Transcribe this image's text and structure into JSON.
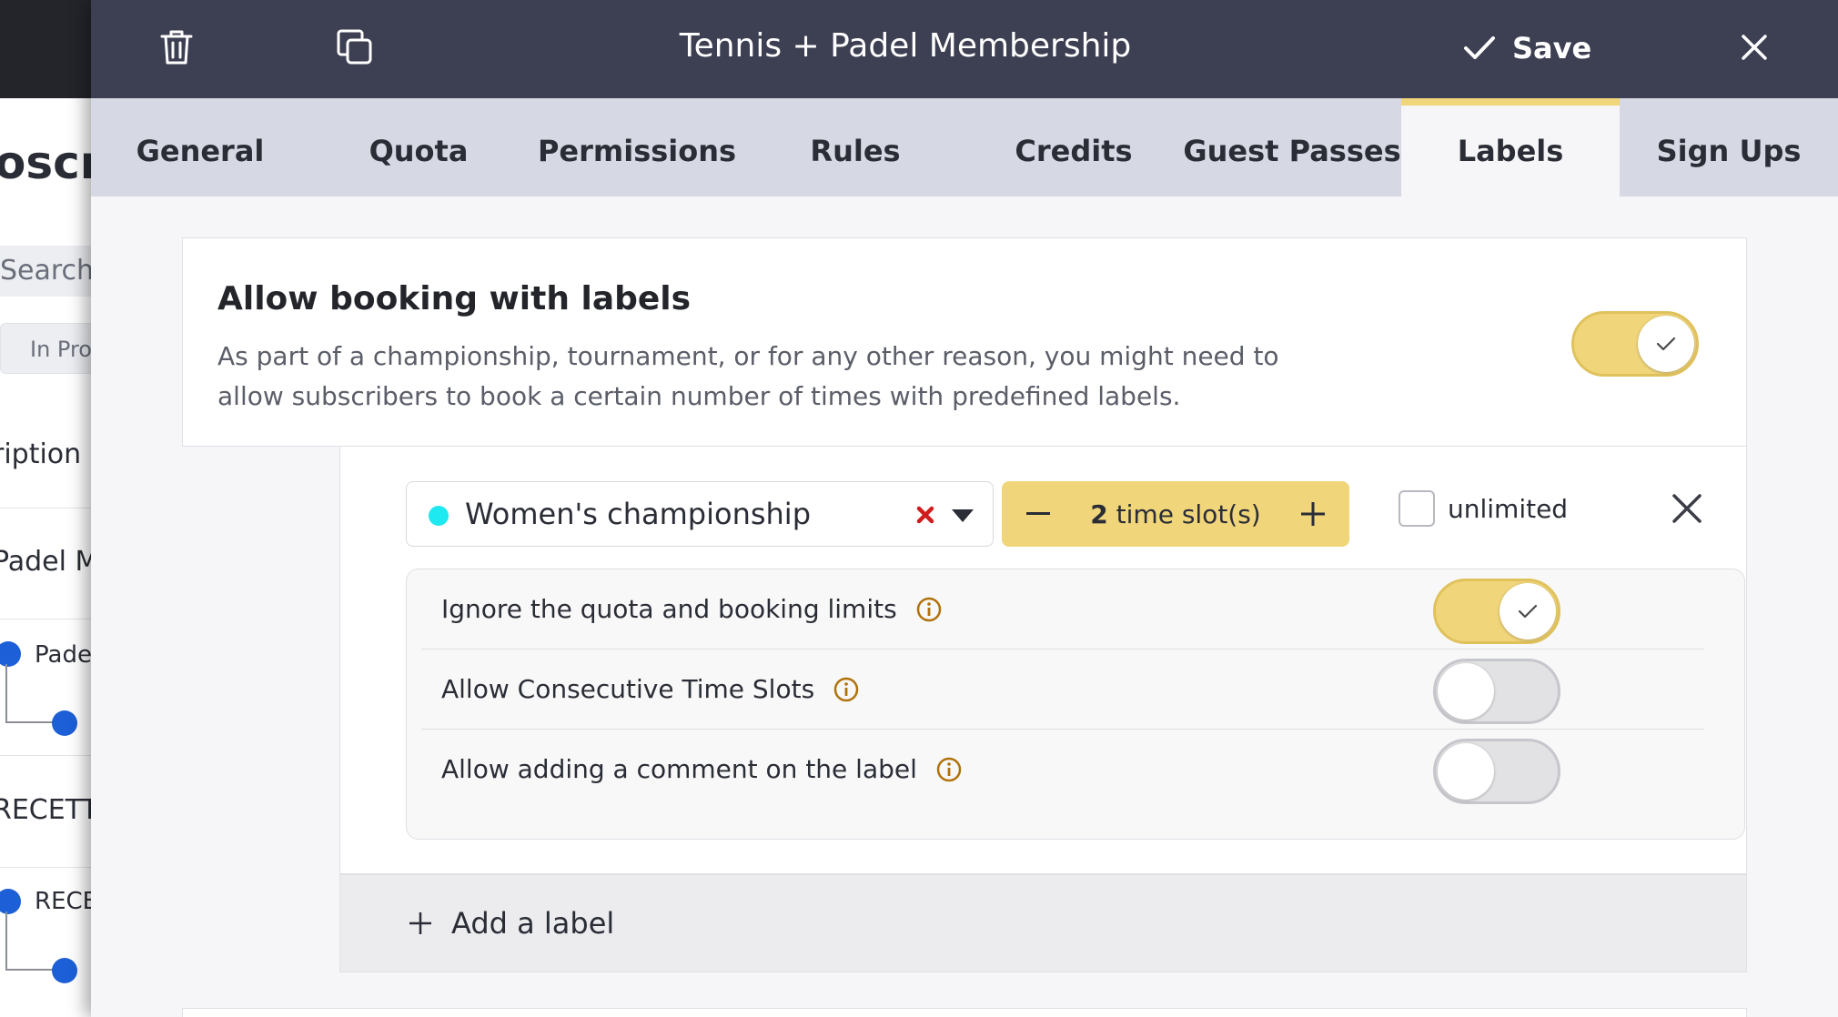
{
  "background_app": {
    "title_partial": "oscrip",
    "search_placeholder_partial": "Search",
    "filter_partial": "In Pro",
    "column_partial": "ription I",
    "row1_partial": "Padel Me",
    "row1_sub_partial": "Pade",
    "row2_partial": "RECETTE",
    "row2_sub_partial": "RECE"
  },
  "header": {
    "title": "Tennis + Padel Membership",
    "save_label": "Save",
    "delete_icon": "trash-icon",
    "duplicate_icon": "copy-icon",
    "close_icon": "close-icon"
  },
  "tabs": [
    {
      "label": "General",
      "active": false
    },
    {
      "label": "Quota",
      "active": false
    },
    {
      "label": "Permissions",
      "active": false
    },
    {
      "label": "Rules",
      "active": false
    },
    {
      "label": "Credits",
      "active": false
    },
    {
      "label": "Guest Passes",
      "active": false
    },
    {
      "label": "Labels",
      "active": true
    },
    {
      "label": "Sign Ups",
      "active": false
    }
  ],
  "labels_section": {
    "title": "Allow booking with labels",
    "description": "As part of a championship, tournament, or for any other reason, you might need to allow subscribers to book a certain number of times with predefined labels.",
    "enabled": true
  },
  "label_item": {
    "selected_label": "Women's championship",
    "label_color": "#1ee8f0",
    "time_slots_count": "2",
    "time_slots_unit": "time slot(s)",
    "unlimited_label": "unlimited",
    "unlimited_checked": false,
    "options": [
      {
        "label": "Ignore the quota and booking limits",
        "enabled": true
      },
      {
        "label": "Allow Consecutive Time Slots",
        "enabled": false
      },
      {
        "label": "Allow adding a comment on the label",
        "enabled": false
      }
    ]
  },
  "add_label": {
    "label": "Add a label"
  },
  "colors": {
    "header_bg": "#3d3f52",
    "tab_bar_bg": "#d6d8e3",
    "accent_yellow": "#f0d57a",
    "info_icon_color": "#b0720a",
    "clear_icon_color": "#d01c1c"
  }
}
